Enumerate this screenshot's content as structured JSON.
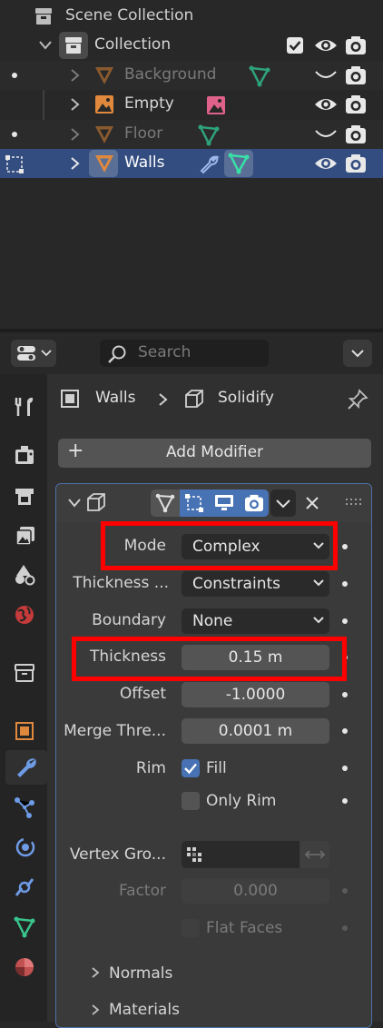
{
  "outliner": {
    "scene_collection": "Scene Collection",
    "collection": "Collection",
    "items": [
      {
        "label": "Background",
        "dimmed": true
      },
      {
        "label": "Empty",
        "dimmed": false
      },
      {
        "label": "Floor",
        "dimmed": true
      },
      {
        "label": "Walls",
        "dimmed": false,
        "selected": true
      }
    ]
  },
  "header": {
    "search_placeholder": "Search"
  },
  "breadcrumb": {
    "object": "Walls",
    "modifier": "Solidify"
  },
  "add_modifier": {
    "label": "Add Modifier",
    "plus": "+"
  },
  "modifier": {
    "mode": {
      "label": "Mode",
      "value": "Complex"
    },
    "thickness_mode": {
      "label": "Thickness ...",
      "value": "Constraints"
    },
    "boundary": {
      "label": "Boundary",
      "value": "None"
    },
    "thickness": {
      "label": "Thickness",
      "value": "0.15 m"
    },
    "offset": {
      "label": "Offset",
      "value": "-1.0000"
    },
    "merge": {
      "label": "Merge Thre...",
      "value": "0.0001 m"
    },
    "rim": {
      "label": "Rim",
      "fill_label": "Fill",
      "fill_checked": true,
      "only_rim_label": "Only Rim",
      "only_rim_checked": false
    },
    "vertex_group": {
      "label": "Vertex Gro..."
    },
    "factor": {
      "label": "Factor",
      "value": "0.000"
    },
    "flat_faces": {
      "label": "Flat Faces"
    },
    "normals": {
      "label": "Normals"
    },
    "materials": {
      "label": "Materials"
    }
  },
  "colors": {
    "selected_row": "#334d80",
    "accent": "#4772b3",
    "highlight": "#ff0000",
    "object_orange": "#e0893d",
    "mesh_green": "#39c48d"
  }
}
